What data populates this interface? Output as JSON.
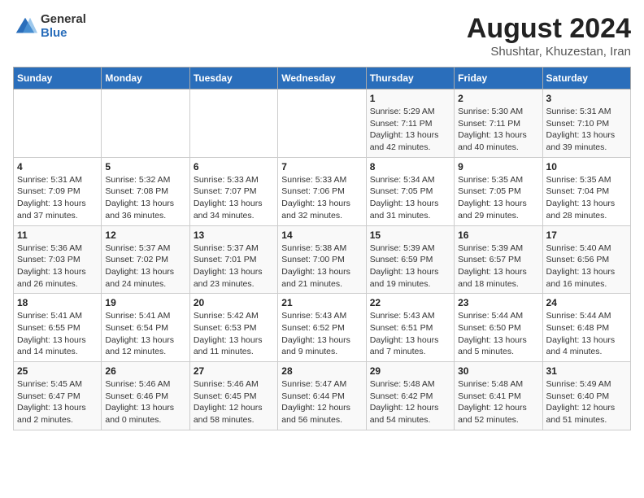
{
  "header": {
    "logo_general": "General",
    "logo_blue": "Blue",
    "title": "August 2024",
    "subtitle": "Shushtar, Khuzestan, Iran"
  },
  "days_of_week": [
    "Sunday",
    "Monday",
    "Tuesday",
    "Wednesday",
    "Thursday",
    "Friday",
    "Saturday"
  ],
  "weeks": [
    [
      {
        "day": "",
        "info": ""
      },
      {
        "day": "",
        "info": ""
      },
      {
        "day": "",
        "info": ""
      },
      {
        "day": "",
        "info": ""
      },
      {
        "day": "1",
        "info": "Sunrise: 5:29 AM\nSunset: 7:11 PM\nDaylight: 13 hours\nand 42 minutes."
      },
      {
        "day": "2",
        "info": "Sunrise: 5:30 AM\nSunset: 7:11 PM\nDaylight: 13 hours\nand 40 minutes."
      },
      {
        "day": "3",
        "info": "Sunrise: 5:31 AM\nSunset: 7:10 PM\nDaylight: 13 hours\nand 39 minutes."
      }
    ],
    [
      {
        "day": "4",
        "info": "Sunrise: 5:31 AM\nSunset: 7:09 PM\nDaylight: 13 hours\nand 37 minutes."
      },
      {
        "day": "5",
        "info": "Sunrise: 5:32 AM\nSunset: 7:08 PM\nDaylight: 13 hours\nand 36 minutes."
      },
      {
        "day": "6",
        "info": "Sunrise: 5:33 AM\nSunset: 7:07 PM\nDaylight: 13 hours\nand 34 minutes."
      },
      {
        "day": "7",
        "info": "Sunrise: 5:33 AM\nSunset: 7:06 PM\nDaylight: 13 hours\nand 32 minutes."
      },
      {
        "day": "8",
        "info": "Sunrise: 5:34 AM\nSunset: 7:05 PM\nDaylight: 13 hours\nand 31 minutes."
      },
      {
        "day": "9",
        "info": "Sunrise: 5:35 AM\nSunset: 7:05 PM\nDaylight: 13 hours\nand 29 minutes."
      },
      {
        "day": "10",
        "info": "Sunrise: 5:35 AM\nSunset: 7:04 PM\nDaylight: 13 hours\nand 28 minutes."
      }
    ],
    [
      {
        "day": "11",
        "info": "Sunrise: 5:36 AM\nSunset: 7:03 PM\nDaylight: 13 hours\nand 26 minutes."
      },
      {
        "day": "12",
        "info": "Sunrise: 5:37 AM\nSunset: 7:02 PM\nDaylight: 13 hours\nand 24 minutes."
      },
      {
        "day": "13",
        "info": "Sunrise: 5:37 AM\nSunset: 7:01 PM\nDaylight: 13 hours\nand 23 minutes."
      },
      {
        "day": "14",
        "info": "Sunrise: 5:38 AM\nSunset: 7:00 PM\nDaylight: 13 hours\nand 21 minutes."
      },
      {
        "day": "15",
        "info": "Sunrise: 5:39 AM\nSunset: 6:59 PM\nDaylight: 13 hours\nand 19 minutes."
      },
      {
        "day": "16",
        "info": "Sunrise: 5:39 AM\nSunset: 6:57 PM\nDaylight: 13 hours\nand 18 minutes."
      },
      {
        "day": "17",
        "info": "Sunrise: 5:40 AM\nSunset: 6:56 PM\nDaylight: 13 hours\nand 16 minutes."
      }
    ],
    [
      {
        "day": "18",
        "info": "Sunrise: 5:41 AM\nSunset: 6:55 PM\nDaylight: 13 hours\nand 14 minutes."
      },
      {
        "day": "19",
        "info": "Sunrise: 5:41 AM\nSunset: 6:54 PM\nDaylight: 13 hours\nand 12 minutes."
      },
      {
        "day": "20",
        "info": "Sunrise: 5:42 AM\nSunset: 6:53 PM\nDaylight: 13 hours\nand 11 minutes."
      },
      {
        "day": "21",
        "info": "Sunrise: 5:43 AM\nSunset: 6:52 PM\nDaylight: 13 hours\nand 9 minutes."
      },
      {
        "day": "22",
        "info": "Sunrise: 5:43 AM\nSunset: 6:51 PM\nDaylight: 13 hours\nand 7 minutes."
      },
      {
        "day": "23",
        "info": "Sunrise: 5:44 AM\nSunset: 6:50 PM\nDaylight: 13 hours\nand 5 minutes."
      },
      {
        "day": "24",
        "info": "Sunrise: 5:44 AM\nSunset: 6:48 PM\nDaylight: 13 hours\nand 4 minutes."
      }
    ],
    [
      {
        "day": "25",
        "info": "Sunrise: 5:45 AM\nSunset: 6:47 PM\nDaylight: 13 hours\nand 2 minutes."
      },
      {
        "day": "26",
        "info": "Sunrise: 5:46 AM\nSunset: 6:46 PM\nDaylight: 13 hours\nand 0 minutes."
      },
      {
        "day": "27",
        "info": "Sunrise: 5:46 AM\nSunset: 6:45 PM\nDaylight: 12 hours\nand 58 minutes."
      },
      {
        "day": "28",
        "info": "Sunrise: 5:47 AM\nSunset: 6:44 PM\nDaylight: 12 hours\nand 56 minutes."
      },
      {
        "day": "29",
        "info": "Sunrise: 5:48 AM\nSunset: 6:42 PM\nDaylight: 12 hours\nand 54 minutes."
      },
      {
        "day": "30",
        "info": "Sunrise: 5:48 AM\nSunset: 6:41 PM\nDaylight: 12 hours\nand 52 minutes."
      },
      {
        "day": "31",
        "info": "Sunrise: 5:49 AM\nSunset: 6:40 PM\nDaylight: 12 hours\nand 51 minutes."
      }
    ]
  ]
}
